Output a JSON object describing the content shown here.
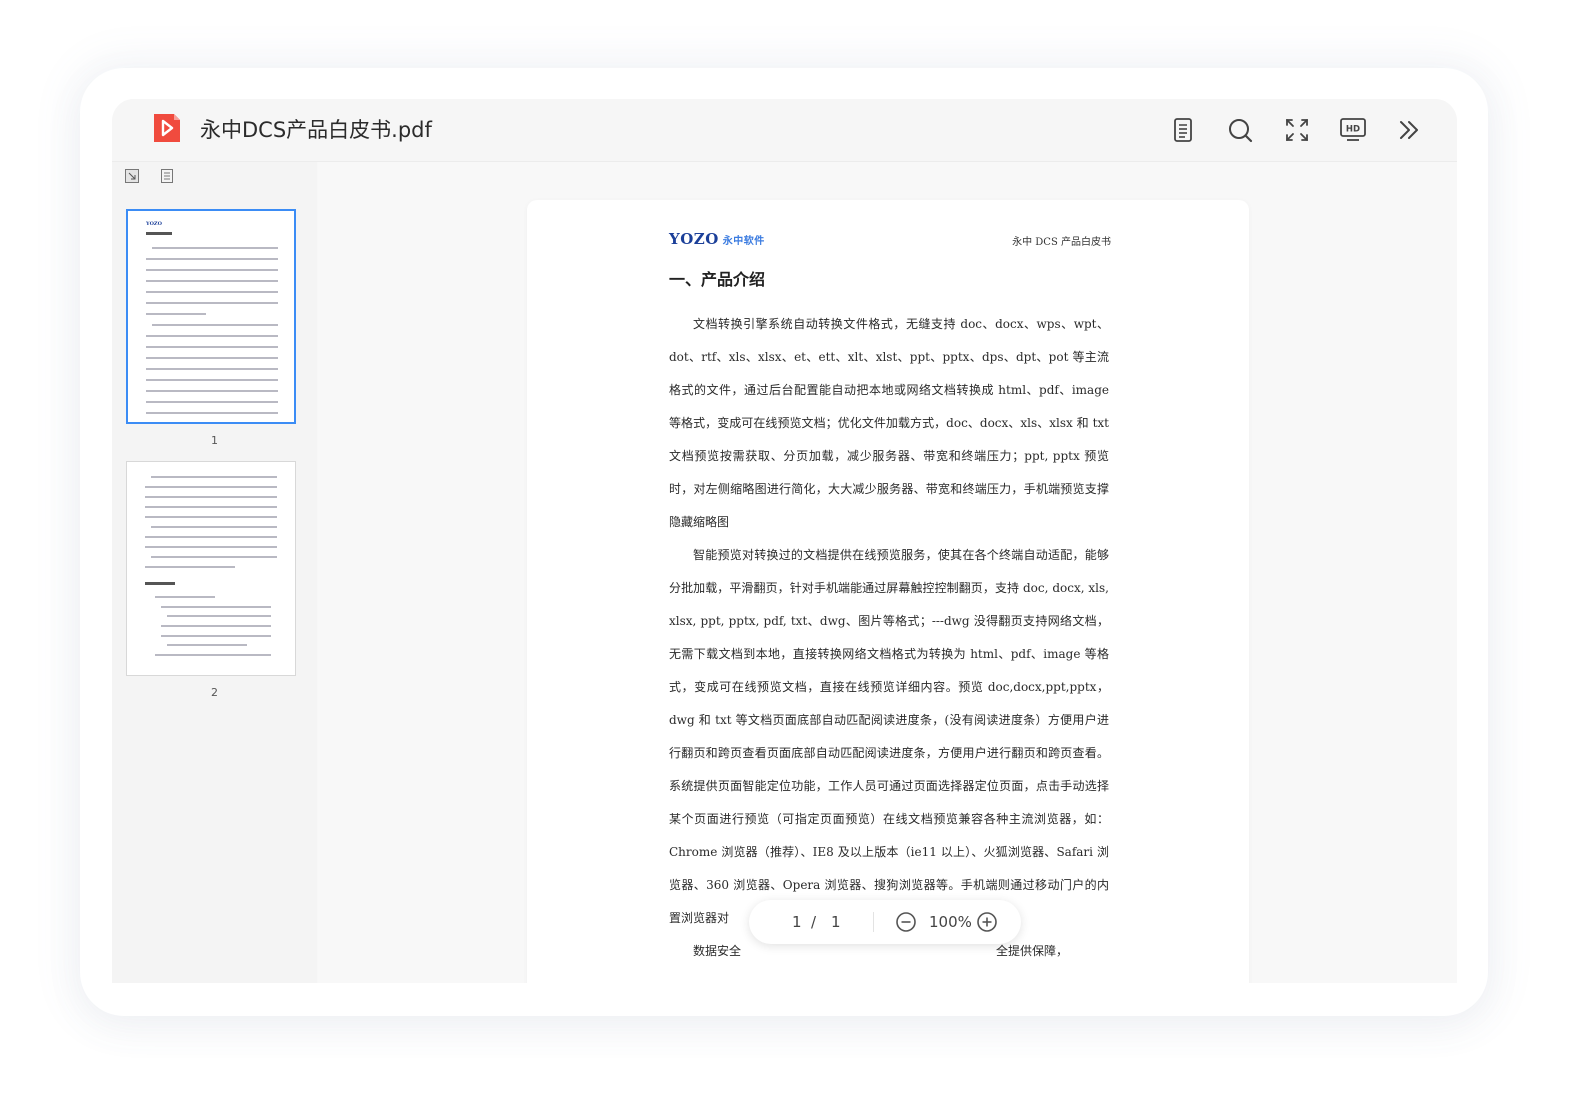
{
  "app": {
    "file_title": "永中DCS产品白皮书.pdf"
  },
  "toolbar": {
    "icons": [
      "outline-icon",
      "search-icon",
      "fullscreen-icon",
      "hd-icon",
      "more-icon"
    ],
    "hd_label": "HD"
  },
  "sidebar": {
    "tabs": [
      "thumbnail-view-icon",
      "outline-view-icon"
    ],
    "thumbnails": [
      {
        "page": "1",
        "active": true
      },
      {
        "page": "2",
        "active": false
      }
    ]
  },
  "document": {
    "logo_text": "YOZO",
    "logo_cn": "永中软件",
    "header_text": "永中 DCS 产品白皮书",
    "heading": "一、产品介绍",
    "paragraphs": [
      "文档转换引擎系统自动转换文件格式，无缝支持 doc、docx、wps、wpt、dot、rtf、xls、xlsx、et、ett、xlt、xlst、ppt、pptx、dps、dpt、pot 等主流格式的文件，通过后台配置能自动把本地或网络文档转换成 html、pdf、image 等格式，变成可在线预览文档；优化文件加载方式，doc、docx、xls、xlsx 和 txt 文档预览按需获取、分页加载，减少服务器、带宽和终端压力；ppt, pptx 预览时，对左侧缩略图进行简化，大大减少服务器、带宽和终端压力，手机端预览支撑隐藏缩略图",
      "智能预览对转换过的文档提供在线预览服务，使其在各个终端自动适配，能够分批加载，平滑翻页，针对手机端能通过屏幕触控控制翻页，支持 doc, docx, xls, xlsx, ppt, pptx, pdf, txt、dwg、图片等格式；---dwg 没得翻页支持网络文档，无需下载文档到本地，直接转换网络文档格式为转换为 html、pdf、image 等格式，变成可在线预览文档，直接在线预览详细内容。预览 doc,docx,ppt,pptx，dwg 和 txt 等文档页面底部自动匹配阅读进度条，(没有阅读进度条）方便用户进行翻页和跨页查看页面底部自动匹配阅读进度条，方便用户进行翻页和跨页查看。系统提供页面智能定位功能，工作人员可通过页面选择器定位页面，点击手动选择某个页面进行预览（可指定页面预览）在线文档预览兼容各种主流浏览器，如：Chrome 浏览器（推荐）、IE8 及以上版本（ie11 以上）、火狐浏览器、Safari 浏览器、360 浏览器、Opera 浏览器、搜狗浏览器等。手机端则通过移动门户的内置浏览器对",
      "数据安全"
    ],
    "trailing_text": "全提供保障，"
  },
  "pager": {
    "current_page": "1",
    "separator": "/",
    "total_pages": "1",
    "zoom": "100%"
  },
  "colors": {
    "accent": "#3b8cf5",
    "pdf_red": "#f04b3e",
    "logo_blue": "#1b3f99"
  }
}
